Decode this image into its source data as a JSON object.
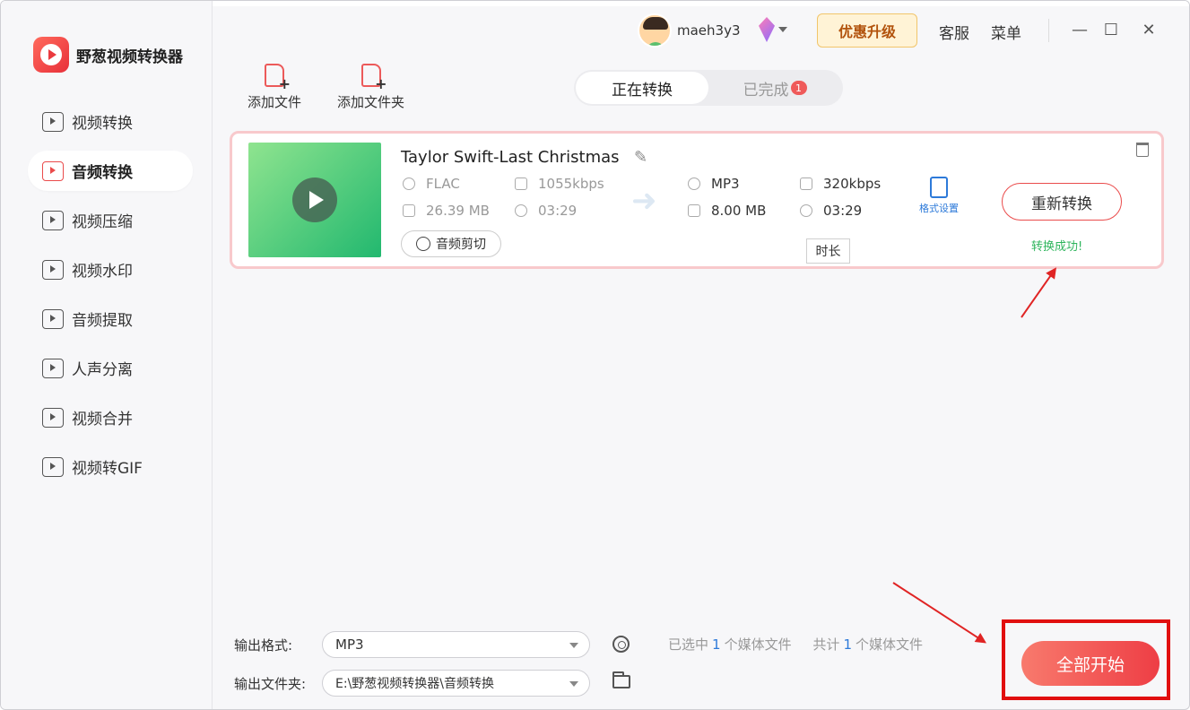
{
  "app": {
    "name": "野葱视频转换器"
  },
  "sidebar": {
    "items": [
      {
        "label": "视频转换",
        "icon": "video-convert-icon"
      },
      {
        "label": "音频转换",
        "icon": "audio-convert-icon",
        "active": true
      },
      {
        "label": "视频压缩",
        "icon": "video-compress-icon"
      },
      {
        "label": "视频水印",
        "icon": "video-watermark-icon"
      },
      {
        "label": "音频提取",
        "icon": "audio-extract-icon"
      },
      {
        "label": "人声分离",
        "icon": "vocal-separate-icon"
      },
      {
        "label": "视频合并",
        "icon": "video-merge-icon"
      },
      {
        "label": "视频转GIF",
        "icon": "video-gif-icon"
      }
    ]
  },
  "header": {
    "username": "maeh3y3",
    "upgrade_label": "优惠升级",
    "service_label": "客服",
    "menu_label": "菜单",
    "minimize": "—",
    "maximize": "☐",
    "close": "✕"
  },
  "toolbar": {
    "add_file": "添加文件",
    "add_folder": "添加文件夹"
  },
  "tabs": {
    "converting": "正在转换",
    "completed": "已完成",
    "completed_count": "1"
  },
  "task": {
    "title": "Taylor Swift-Last Christmas",
    "input": {
      "format": "FLAC",
      "bitrate": "1055kbps",
      "size": "26.39 MB",
      "duration": "03:29"
    },
    "output": {
      "format": "MP3",
      "bitrate": "320kbps",
      "size": "8.00 MB",
      "duration": "03:29"
    },
    "trim_label": "音频剪切",
    "format_settings_label": "格式设置",
    "reconvert_label": "重新转换",
    "status": "转换成功!",
    "tooltip": "时长"
  },
  "bottom": {
    "output_format_label": "输出格式:",
    "output_format_value": "MP3",
    "output_folder_label": "输出文件夹:",
    "output_folder_value": "E:\\野葱视频转换器\\音频转换",
    "selected_prefix": "已选中",
    "selected_count": "1",
    "selected_suffix": "个媒体文件",
    "total_prefix": "共计",
    "total_count": "1",
    "total_suffix": "个媒体文件",
    "start_all_label": "全部开始"
  },
  "colors": {
    "accent": "#ea4b4b",
    "success": "#2fb55d",
    "link": "#2d7ad9",
    "annotation": "#e10f0f"
  }
}
